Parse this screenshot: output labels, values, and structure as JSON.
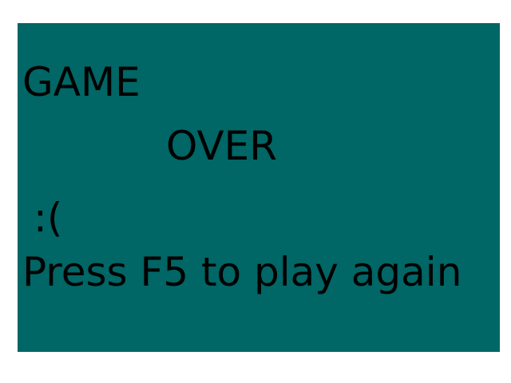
{
  "colors": {
    "panel_background": "#006666",
    "text": "#000000",
    "page_background": "#ffffff"
  },
  "game_over": {
    "word_1": "GAME",
    "word_2": "OVER",
    "emoticon": ":(",
    "instruction": "Press F5 to play again"
  }
}
